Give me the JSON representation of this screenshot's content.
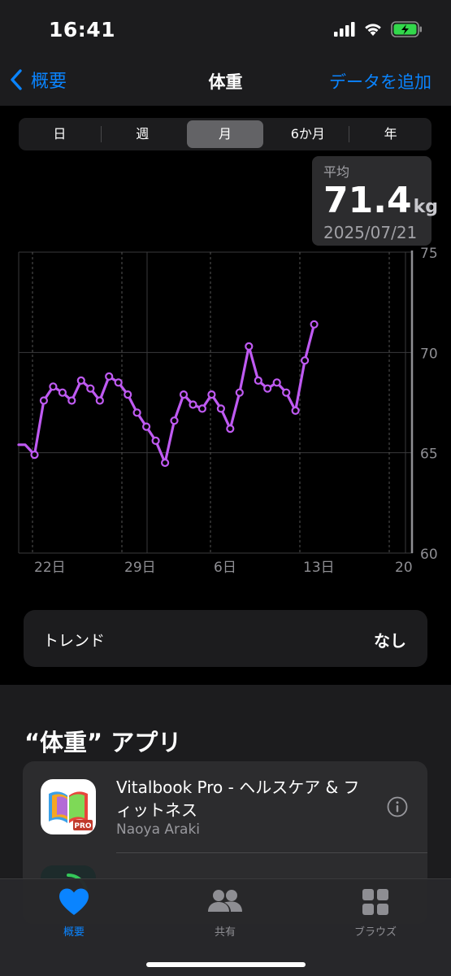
{
  "status_bar": {
    "time": "16:41"
  },
  "nav": {
    "back_label": "概要",
    "title": "体重",
    "add_label": "データを追加"
  },
  "segments": [
    {
      "label": "日",
      "active": false
    },
    {
      "label": "週",
      "active": false
    },
    {
      "label": "月",
      "active": true
    },
    {
      "label": "6か月",
      "active": false
    },
    {
      "label": "年",
      "active": false
    }
  ],
  "average": {
    "label": "平均",
    "value": "71.4",
    "unit": "kg",
    "date": "2025/07/21"
  },
  "chart_data": {
    "type": "line",
    "y_ticks": [
      "75",
      "70",
      "65",
      "60"
    ],
    "ylim": [
      60,
      75
    ],
    "x_ticks": [
      "22日",
      "29日",
      "6日",
      "13日",
      "20"
    ],
    "series_color": "#bf5af2",
    "series": [
      {
        "values": [
          65.4,
          64.9,
          67.6,
          68.3,
          68.0,
          67.6,
          68.6,
          68.2,
          67.6,
          68.8,
          68.5,
          67.9,
          67.0,
          66.3,
          65.6,
          64.5,
          66.6,
          67.9,
          67.4,
          67.2,
          67.9,
          67.2,
          66.2,
          68.0,
          70.3,
          68.6,
          68.2,
          68.5,
          68.0,
          67.1,
          69.6,
          71.4
        ]
      }
    ],
    "grid": true
  },
  "trend": {
    "label": "トレンド",
    "value": "なし"
  },
  "apps": {
    "title": "“体重” アプリ",
    "items": [
      {
        "name": "Vitalbook Pro - ヘルスケア & フィットネス",
        "developer": "Naoya Araki",
        "icon_badge": "PRO"
      }
    ]
  },
  "tabbar": {
    "items": [
      {
        "label": "概要",
        "active": true
      },
      {
        "label": "共有",
        "active": false
      },
      {
        "label": "ブラウズ",
        "active": false
      }
    ]
  },
  "colors": {
    "accent": "#0a84ff",
    "series": "#bf5af2"
  }
}
